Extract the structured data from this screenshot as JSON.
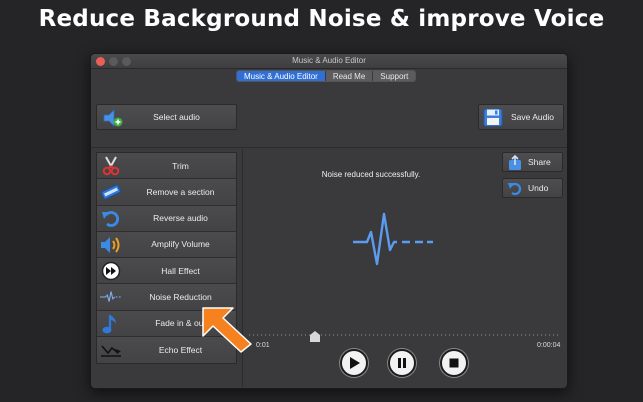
{
  "headline": "Reduce Background Noise & improve Voice",
  "window": {
    "title": "Music & Audio Editor",
    "tabs": [
      {
        "label": "Music & Audio Editor",
        "active": true
      },
      {
        "label": "Read Me",
        "active": false
      },
      {
        "label": "Support",
        "active": false
      }
    ]
  },
  "buttons": {
    "select_audio": "Select audio",
    "save_audio": "Save Audio",
    "share": "Share",
    "undo": "Undo"
  },
  "tools": [
    {
      "label": "Trim",
      "icon": "scissors-icon"
    },
    {
      "label": "Remove a section",
      "icon": "remove-tag-icon"
    },
    {
      "label": "Reverse audio",
      "icon": "reverse-arrow-icon"
    },
    {
      "label": "Amplify Volume",
      "icon": "speaker-volume-icon"
    },
    {
      "label": "Hall Effect",
      "icon": "fast-forward-circle-icon"
    },
    {
      "label": "Noise Reduction",
      "icon": "waveform-icon"
    },
    {
      "label": "Fade in & out",
      "icon": "music-note-icon"
    },
    {
      "label": "Echo Effect",
      "icon": "echo-curve-icon"
    }
  ],
  "status_message": "Noise reduced successfully.",
  "player": {
    "current_time": "0:01",
    "total_time": "0:00:04",
    "progress": 0.21
  },
  "colors": {
    "accent": "#2f6fd6",
    "waveform": "#5b9bf0",
    "arrow": "#f5821f"
  }
}
